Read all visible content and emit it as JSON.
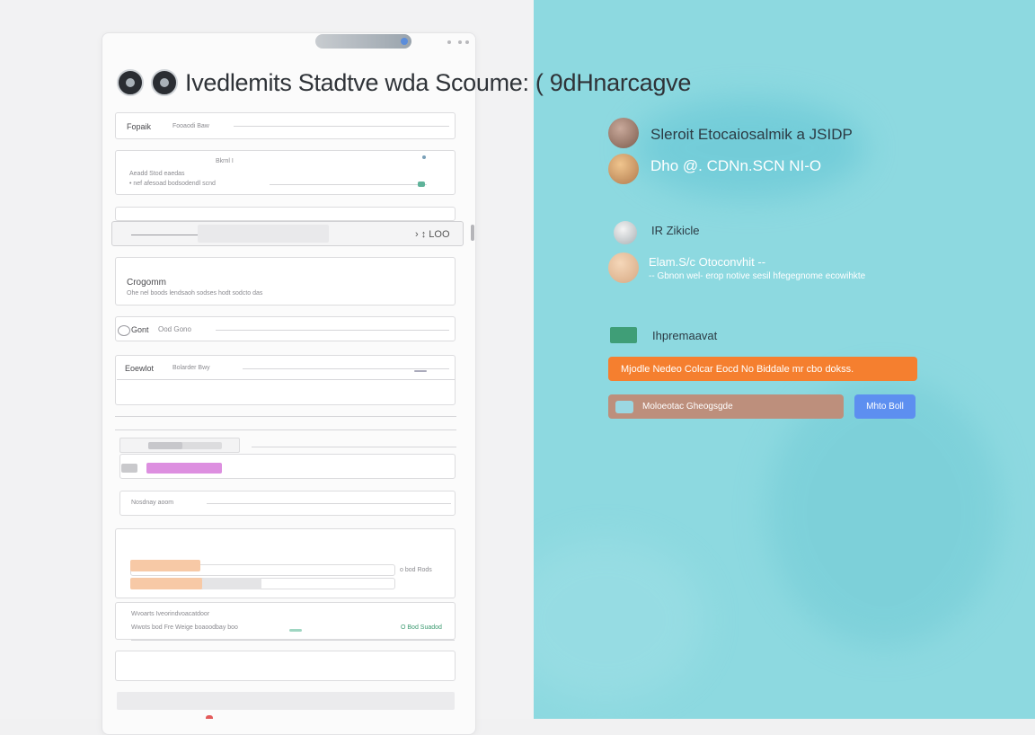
{
  "header": {
    "title": "Ivedlemits Stadtve wda Scoume: ( 9dHnarcagve"
  },
  "tabs": {
    "window_dots": "• •"
  },
  "form": {
    "row1": {
      "label": "Fopaik",
      "value": "Fooaodi Baw"
    },
    "row2": {
      "label_a": "Bkrnl  I",
      "line1": "Aeadd  Stod eaedas",
      "line2": "• nef afesoad bodsodendl scnd"
    },
    "row3": {
      "value": "› ↕ LOO"
    },
    "row4": {
      "title": "Crogomm",
      "desc": "Ohe nel boods lendsaoh sodses hodt sodcto das"
    },
    "row5": {
      "label": "Gont",
      "value": "Ood Gono"
    },
    "row6": {
      "label": "Eoewlot",
      "value": "Bolarder Bwy"
    },
    "row7": {
      "label": "Nosdnay aoom"
    },
    "row8": {
      "label": "o bod Rods"
    },
    "row9": {
      "line1": "Wvoarts Iveorindvoacatdoor",
      "line2": "Wwots bod Fre Weige boaoodbay boo",
      "badge": "O Bod Suadod"
    }
  },
  "right": {
    "contact1": "Sleroit Etocaiosalmik a JSIDP",
    "contact2": "Dho @. CDNn.SCN  NI-O",
    "section_label": "IR Zikicle",
    "person_name": "Elam.S/c Otoconvhit --",
    "person_desc": "-- Gbnon wel- erop notive sesil hfegegnome ecowihkte",
    "section2": "Ihpremaavat",
    "orange_button": "Mjodle Nedeo Colcar Eocd No Biddale mr cbo dokss.",
    "field_text": "Moloeotac Gheogsgde",
    "blue_button": "Mhto Boll"
  },
  "colors": {
    "accent_orange": "#f57f2f",
    "accent_blue": "#5d8ff0",
    "panel_teal": "#8dd9e0",
    "field_brown": "#bd8f7c"
  }
}
